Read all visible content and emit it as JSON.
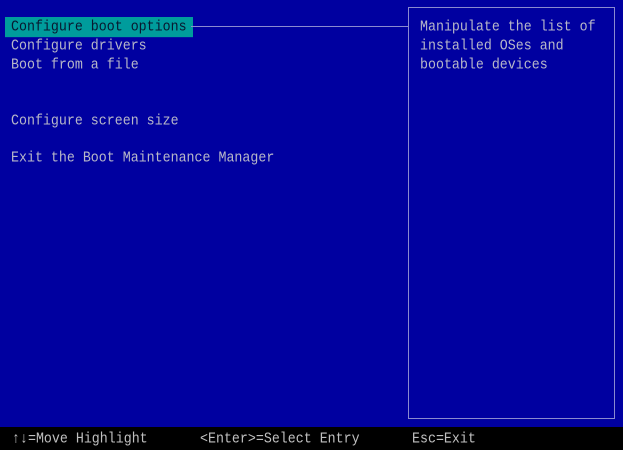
{
  "menu": {
    "items": [
      {
        "label": "Configure boot options",
        "selected": true
      },
      {
        "label": "Configure drivers"
      },
      {
        "label": "Boot from a file"
      },
      {
        "label": "Configure screen size"
      },
      {
        "label": "Exit the Boot Maintenance Manager"
      }
    ]
  },
  "help": {
    "lines": [
      "Manipulate the list of",
      "installed OSes and",
      "bootable devices"
    ]
  },
  "footer": {
    "move": "↑↓=Move Highlight",
    "select": "<Enter>=Select Entry",
    "exit": "Esc=Exit"
  },
  "colors": {
    "background": "#0000a0",
    "highlight": "#009c9c",
    "footer": "#000000"
  }
}
